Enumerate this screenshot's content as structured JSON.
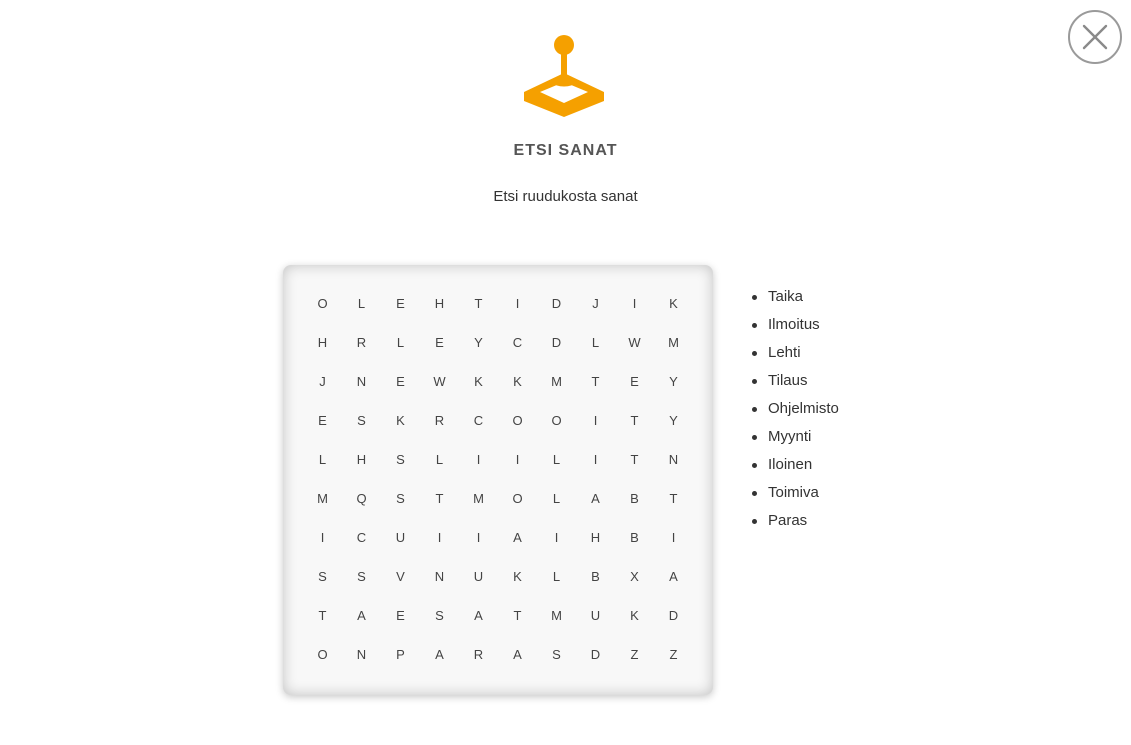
{
  "header": {
    "icon": "joystick-icon",
    "title": "ETSI SANAT",
    "subtitle": "Etsi ruudukosta sanat",
    "accent_color": "#F5A000"
  },
  "close_button": {
    "icon": "close-icon"
  },
  "grid": {
    "rows": [
      [
        "O",
        "L",
        "E",
        "H",
        "T",
        "I",
        "D",
        "J",
        "I",
        "K"
      ],
      [
        "H",
        "R",
        "L",
        "E",
        "Y",
        "C",
        "D",
        "L",
        "W",
        "M"
      ],
      [
        "J",
        "N",
        "E",
        "W",
        "K",
        "K",
        "M",
        "T",
        "E",
        "Y"
      ],
      [
        "E",
        "S",
        "K",
        "R",
        "C",
        "O",
        "O",
        "I",
        "T",
        "Y"
      ],
      [
        "L",
        "H",
        "S",
        "L",
        "I",
        "I",
        "L",
        "I",
        "T",
        "N"
      ],
      [
        "M",
        "Q",
        "S",
        "T",
        "M",
        "O",
        "L",
        "A",
        "B",
        "T"
      ],
      [
        "I",
        "C",
        "U",
        "I",
        "I",
        "A",
        "I",
        "H",
        "B",
        "I"
      ],
      [
        "S",
        "S",
        "V",
        "N",
        "U",
        "K",
        "L",
        "B",
        "X",
        "A"
      ],
      [
        "T",
        "A",
        "E",
        "S",
        "A",
        "T",
        "M",
        "U",
        "K",
        "D"
      ],
      [
        "O",
        "N",
        "P",
        "A",
        "R",
        "A",
        "S",
        "D",
        "Z",
        "Z"
      ]
    ]
  },
  "word_list": [
    "Taika",
    "Ilmoitus",
    "Lehti",
    "Tilaus",
    "Ohjelmisto",
    "Myynti",
    "Iloinen",
    "Toimiva",
    "Paras"
  ]
}
